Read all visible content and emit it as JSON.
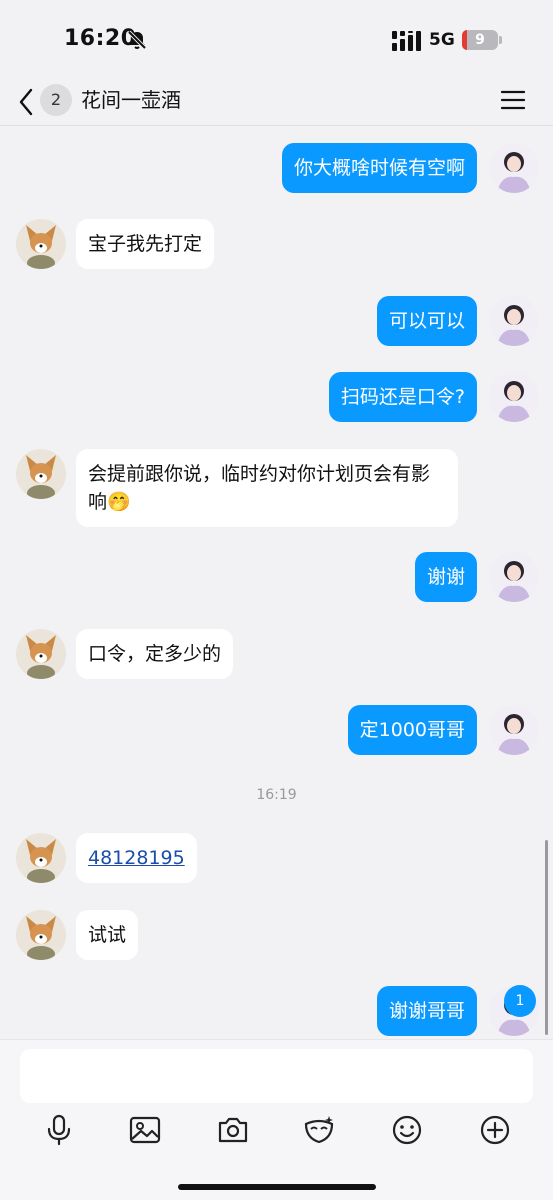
{
  "status_bar": {
    "time": "16:20",
    "network": "5G",
    "battery": "9",
    "icons": [
      "bell-slash-icon",
      "signal-icon",
      "battery-icon"
    ]
  },
  "header": {
    "unread_count": "2",
    "title": "花间一壶酒",
    "icons": [
      "chevron-left-icon",
      "menu-icon"
    ]
  },
  "messages": [
    {
      "side": "out",
      "text": "你大概啥时候有空啊"
    },
    {
      "side": "in",
      "text": "宝子我先打定"
    },
    {
      "side": "out",
      "text": "可以可以"
    },
    {
      "side": "out",
      "text": "扫码还是口令?"
    },
    {
      "side": "in",
      "text": "会提前跟你说，临时约对你计划页会有影响🤭"
    },
    {
      "side": "out",
      "text": "谢谢"
    },
    {
      "side": "in",
      "text": "口令，定多少的"
    },
    {
      "side": "out",
      "text": "定1000哥哥"
    },
    {
      "side": "in",
      "text": "48128195"
    },
    {
      "side": "in",
      "text": "试试"
    },
    {
      "side": "out",
      "text": "谢谢哥哥"
    }
  ],
  "timestamp": "16:19",
  "new_message_badge": "1",
  "toolbar_icons": [
    "microphone-icon",
    "image-icon",
    "camera-icon",
    "mask-icon",
    "emoji-icon",
    "plus-icon"
  ],
  "colors": {
    "outgoing_bubble": "#0a99ff",
    "incoming_bubble": "#ffffff",
    "background": "#f2f2f4",
    "link": "#1b4ea8"
  }
}
